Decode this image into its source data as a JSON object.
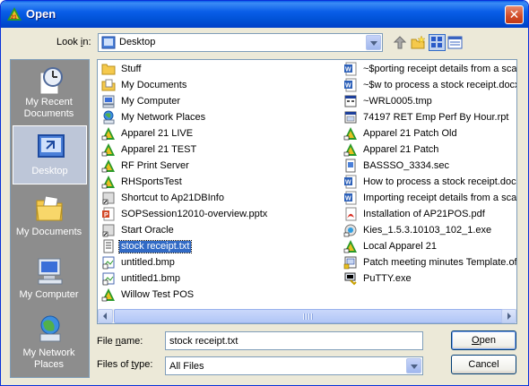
{
  "window": {
    "title": "Open"
  },
  "toolbar": {
    "lookin_label": "Look in:",
    "lookin_value": "Desktop",
    "up_icon": "up-folder-icon",
    "new_folder_icon": "new-folder-icon",
    "view_icon": "views-menu-icon",
    "view2_icon": "details-view-icon"
  },
  "places": [
    {
      "label": "My Recent Documents",
      "icon": "recent-documents-icon",
      "selected": false
    },
    {
      "label": "Desktop",
      "icon": "desktop-icon",
      "selected": true
    },
    {
      "label": "My Documents",
      "icon": "my-documents-icon",
      "selected": false
    },
    {
      "label": "My Computer",
      "icon": "my-computer-icon",
      "selected": false
    },
    {
      "label": "My Network Places",
      "icon": "network-places-icon",
      "selected": false
    }
  ],
  "files": {
    "column1": [
      {
        "name": "Stuff",
        "icon": "folder"
      },
      {
        "name": "My Documents",
        "icon": "mydocs"
      },
      {
        "name": "My Computer",
        "icon": "computer"
      },
      {
        "name": "My Network Places",
        "icon": "network"
      },
      {
        "name": "Apparel 21 LIVE",
        "icon": "a21"
      },
      {
        "name": "Apparel 21 TEST",
        "icon": "a21"
      },
      {
        "name": "RF Print Server",
        "icon": "a21"
      },
      {
        "name": "RHSportsTest",
        "icon": "a21"
      },
      {
        "name": "Shortcut to Ap21DBInfo",
        "icon": "shortcut"
      },
      {
        "name": "SOPSession12010-overview.pptx",
        "icon": "pptx"
      },
      {
        "name": "Start Oracle",
        "icon": "shortcut"
      },
      {
        "name": "stock receipt.txt",
        "icon": "txt",
        "selected": true
      },
      {
        "name": "untitled.bmp",
        "icon": "bmp"
      },
      {
        "name": "untitled1.bmp",
        "icon": "bmp"
      },
      {
        "name": "Willow Test POS",
        "icon": "a21"
      }
    ],
    "column2": [
      {
        "name": "~$porting receipt details from a scan",
        "icon": "docx"
      },
      {
        "name": "~$w to process a stock receipt.docx",
        "icon": "docx"
      },
      {
        "name": "~WRL0005.tmp",
        "icon": "tmp"
      },
      {
        "name": "74197 RET Emp Perf By Hour.rpt",
        "icon": "rpt"
      },
      {
        "name": "Apparel 21 Patch Old",
        "icon": "a21"
      },
      {
        "name": "Apparel 21 Patch",
        "icon": "a21"
      },
      {
        "name": "BASSSO_3334.sec",
        "icon": "sec"
      },
      {
        "name": "How to process a stock receipt.docx",
        "icon": "docx"
      },
      {
        "name": "Importing receipt details from a scan",
        "icon": "docx"
      },
      {
        "name": "Installation of AP21POS.pdf",
        "icon": "pdf"
      },
      {
        "name": "Kies_1.5.3.10103_102_1.exe",
        "icon": "exe"
      },
      {
        "name": "Local Apparel 21",
        "icon": "a21"
      },
      {
        "name": "Patch meeting minutes Template.oft",
        "icon": "oft"
      },
      {
        "name": "PuTTY.exe",
        "icon": "putty"
      }
    ]
  },
  "form": {
    "file_name_label": "File name:",
    "file_name_value": "stock receipt.txt",
    "files_of_type_label": "Files of type:",
    "files_of_type_value": "All Files",
    "open_label": "Open",
    "cancel_label": "Cancel"
  }
}
